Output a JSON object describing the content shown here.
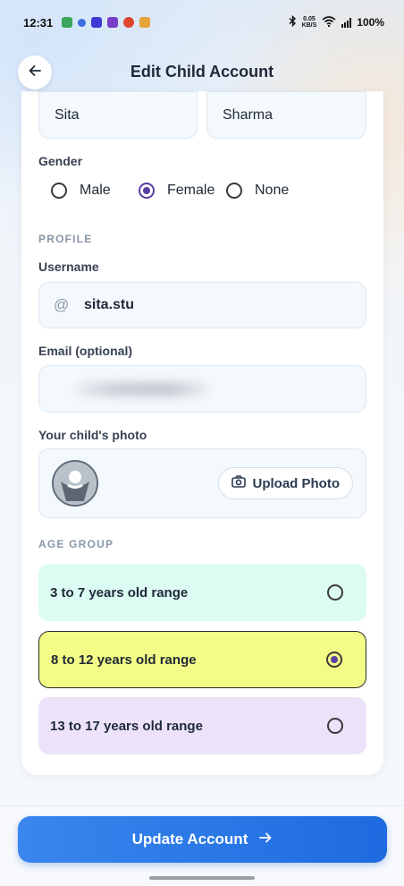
{
  "status_bar": {
    "time": "12:31",
    "battery": "100%",
    "speed_top": "0.05",
    "speed_bottom": "KB/S"
  },
  "header": {
    "title": "Edit Child Account"
  },
  "form": {
    "first_name": "Sita",
    "last_name": "Sharma",
    "gender_label": "Gender",
    "gender_options": [
      "Male",
      "Female",
      "None"
    ],
    "gender_selected": "Female",
    "profile_section": "PROFILE",
    "username_label": "Username",
    "username_prefix": "@",
    "username_value": "sita.stu",
    "email_label": "Email (optional)",
    "photo_label": "Your child's photo",
    "upload_label": "Upload Photo",
    "age_section": "AGE GROUP",
    "age_options": [
      {
        "label": "3 to 7 years old range",
        "color": "#dcfbf3",
        "selected": false
      },
      {
        "label": "8 to 12 years old range",
        "color": "#f3fc86",
        "selected": true
      },
      {
        "label": "13 to 17 years old range",
        "color": "#ece3fb",
        "selected": false
      }
    ]
  },
  "actions": {
    "update_label": "Update Account"
  },
  "colors": {
    "accent": "#5b3fa3",
    "primary_button": "#2a78e8"
  }
}
